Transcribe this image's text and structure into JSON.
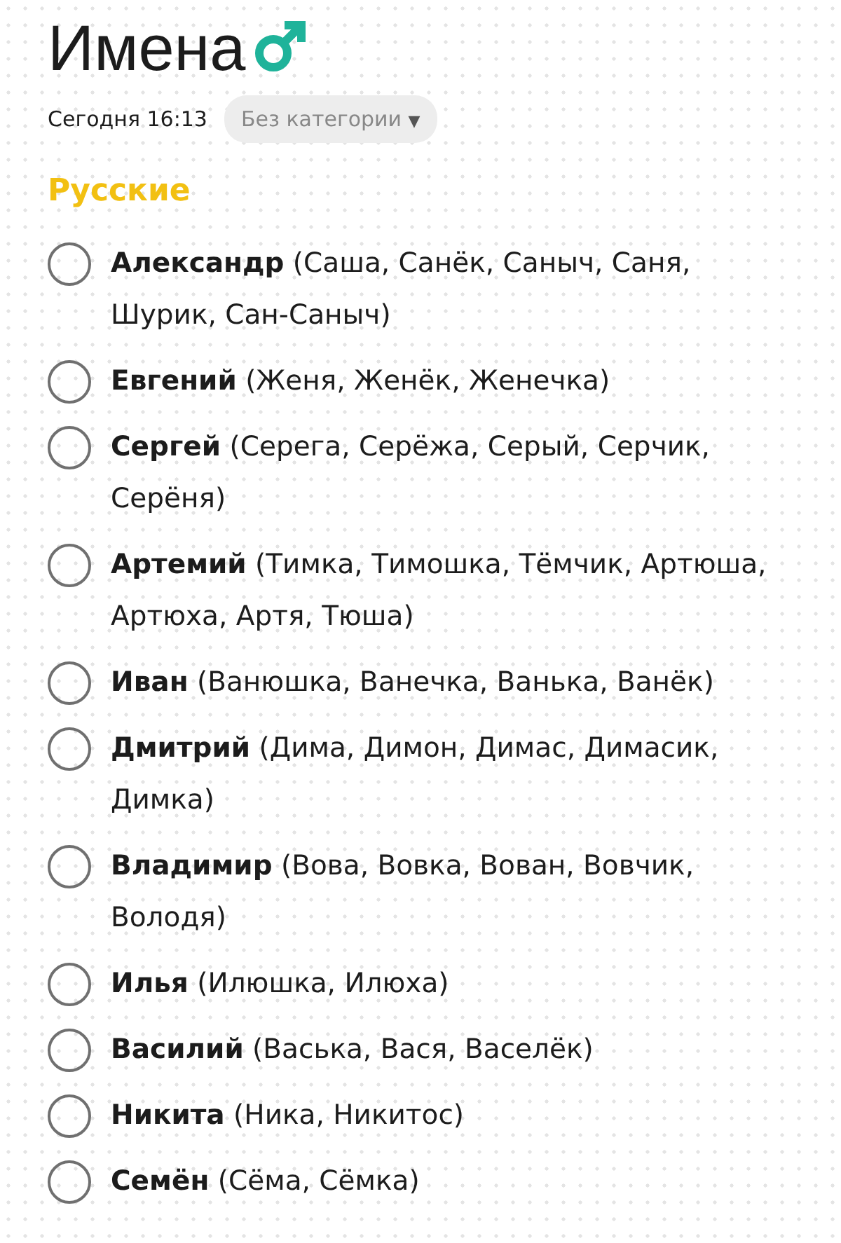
{
  "title": "Имена",
  "date": "Сегодня 16:13",
  "category": {
    "label": "Без категории",
    "caret": "▼"
  },
  "section": "Русские",
  "items": [
    {
      "text": "**Александр** (Саша, Санёк, Саныч, Саня, Шурик, Сан-Саныч)",
      "checked": false
    },
    {
      "text": "**Евгений** (Женя, Женёк, Женечка)",
      "checked": false
    },
    {
      "text": "**Сергей** (Серега, Серёжа, Серый, Серчик, Серёня)",
      "checked": false
    },
    {
      "text": "**Артемий** (Тимка, Тимошка, Тёмчик, Артюша, Артюха, Артя, Тюша)",
      "checked": false
    },
    {
      "text": "**Иван** (Ванюшка, Ванечка, Ванька, Ванёк)",
      "checked": false
    },
    {
      "text": "**Дмитрий** (Дима, Димон, Димас, Димасик, Димка)",
      "checked": false
    },
    {
      "text": "**Владимир** (Вова, Вовка, Вован, Вовчик, Володя)",
      "checked": false
    },
    {
      "text": "**Илья** (Илюшка, Илюха)",
      "checked": false
    },
    {
      "text": "**Василий** (Васька, Вася, Васелёк)",
      "checked": false
    },
    {
      "text": "**Никита** (Ника, Никитос)",
      "checked": false
    },
    {
      "text": "**Семён** (Сёма, Сёмка)",
      "checked": false
    }
  ]
}
